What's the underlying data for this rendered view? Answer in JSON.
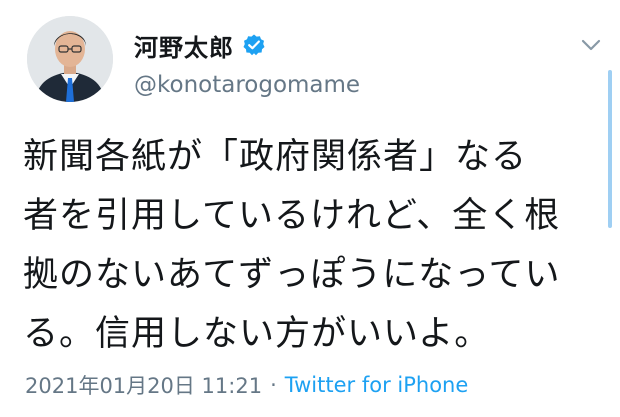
{
  "author": {
    "display_name": "河野太郎",
    "handle": "@konotarogomame",
    "verified": true
  },
  "tweet": {
    "lines": [
      "新聞各紙が「政府関係者」なる",
      "者を引用しているけれど、全く根",
      "拠のないあてずっぽうになってい",
      "る。信用しない方がいいよ。"
    ],
    "timestamp": "2021年01月20日 11:21",
    "separator": "·",
    "source": "Twitter for iPhone"
  },
  "icons": {
    "verified": "verified-badge-icon",
    "menu": "chevron-down-icon"
  },
  "colors": {
    "text": "#14171a",
    "secondary": "#657786",
    "link": "#1da1f2",
    "verified": "#1da1f2"
  }
}
